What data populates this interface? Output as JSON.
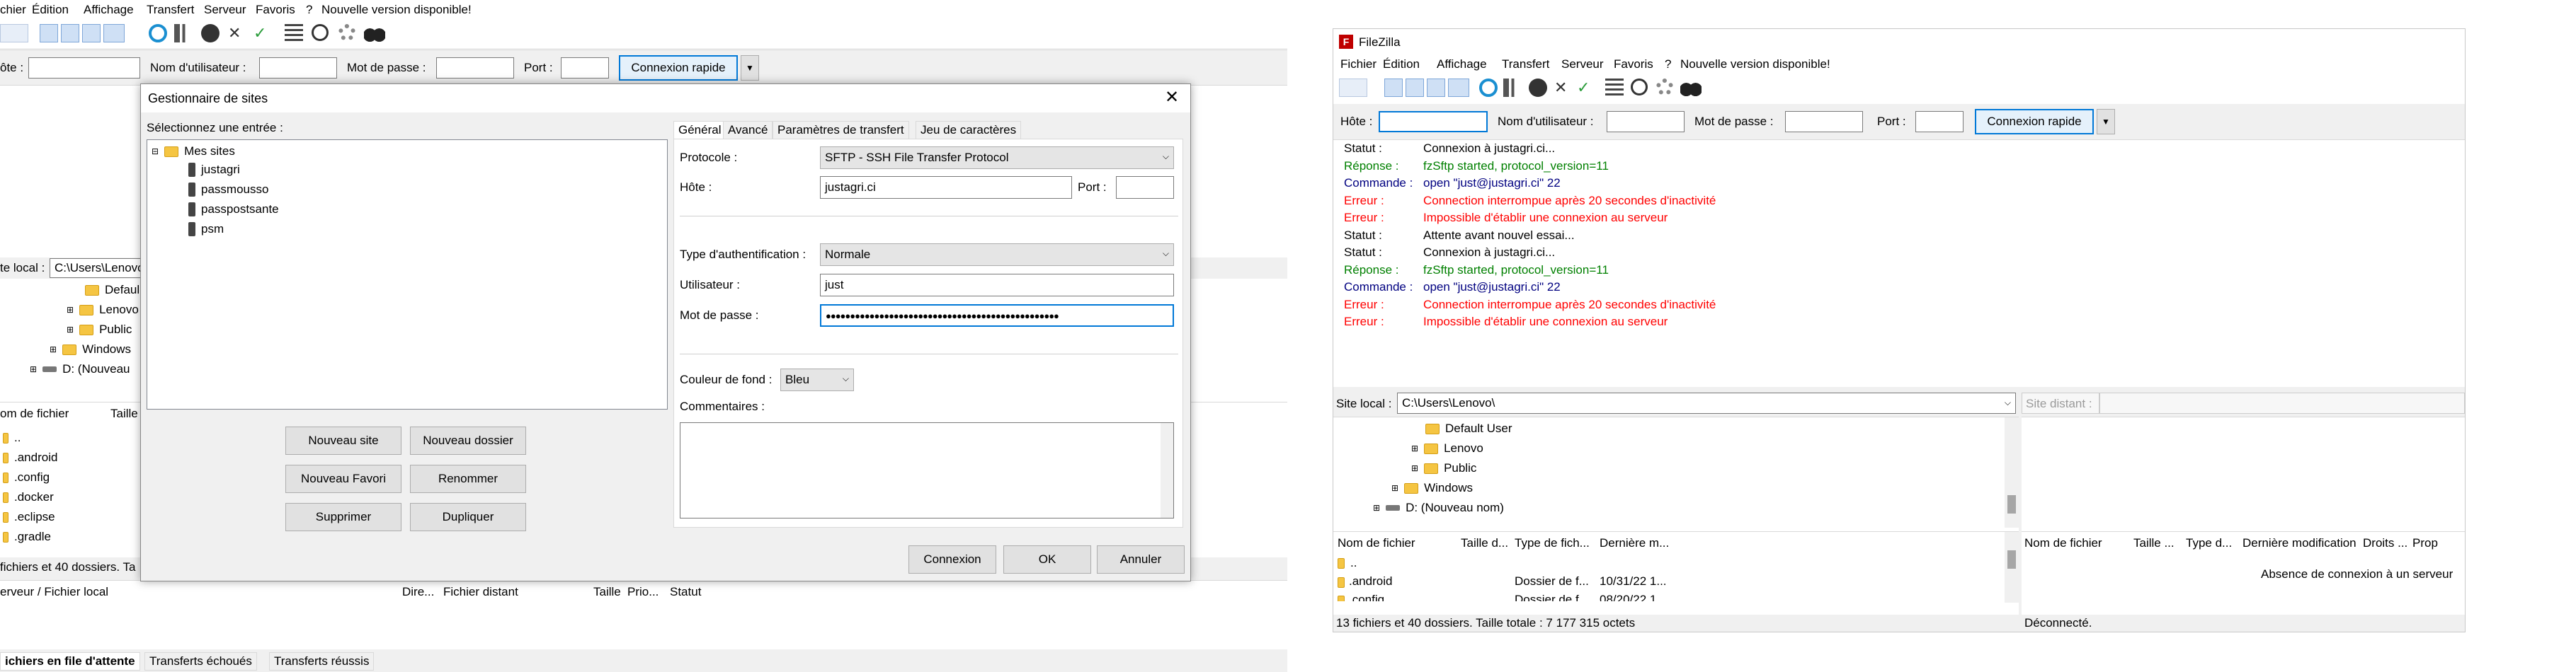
{
  "left_app": {
    "menu": [
      "chier",
      "Édition",
      "Affichage",
      "Transfert",
      "Serveur",
      "Favoris",
      "?",
      "Nouvelle version disponible!"
    ],
    "quickconnect": {
      "host_label": "ôte :",
      "user_label": "Nom d'utilisateur :",
      "pass_label": "Mot de passe :",
      "port_label": "Port :",
      "button": "Connexion rapide"
    },
    "local_site_label": "te local :",
    "local_site_path": "C:\\Users\\Lenovo",
    "tree": [
      "Defaul",
      "Lenovo",
      "Public",
      "Windows",
      "D: (Nouveau"
    ],
    "file_headers": [
      "om de fichier",
      "Taille"
    ],
    "files": [
      "..",
      ".android",
      ".config",
      ".docker",
      ".eclipse",
      ".gradle"
    ],
    "status_bar": "fichiers et 40 dossiers. Ta",
    "queue_headers": [
      "erveur / Fichier local",
      "Dire...",
      "Fichier distant",
      "Taille",
      "Prio...",
      "Statut"
    ],
    "queue_tabs": [
      "ichiers en file d'attente",
      "Transferts échoués",
      "Transferts réussis"
    ]
  },
  "dialog": {
    "title": "Gestionnaire de sites",
    "select_label": "Sélectionnez une entrée :",
    "tree_root": "Mes sites",
    "sites": [
      "justagri",
      "passmousso",
      "passpostsante",
      "psm"
    ],
    "buttons": {
      "new_site": "Nouveau site",
      "new_folder": "Nouveau dossier",
      "new_bookmark": "Nouveau Favori",
      "rename": "Renommer",
      "delete": "Supprimer",
      "duplicate": "Dupliquer"
    },
    "tabs": [
      "Général",
      "Avancé",
      "Paramètres de transfert",
      "Jeu de caractères"
    ],
    "fields": {
      "protocol_label": "Protocole :",
      "protocol_value": "SFTP - SSH File Transfer Protocol",
      "host_label": "Hôte :",
      "host_value": "justagri.ci",
      "port_label": "Port :",
      "port_value": "",
      "auth_label": "Type d'authentification :",
      "auth_value": "Normale",
      "user_label": "Utilisateur :",
      "user_value": "just",
      "pass_label": "Mot de passe :",
      "pass_value": "●●●●●●●●●●●●●●●●●●●●●●●●●●●●●●●●●●●●●●●●●●●●●●●●",
      "bg_color_label": "Couleur de fond :",
      "bg_color_value": "Bleu",
      "comments_label": "Commentaires :"
    },
    "footer": {
      "connect": "Connexion",
      "ok": "OK",
      "cancel": "Annuler"
    }
  },
  "right_app": {
    "title": "FileZilla",
    "menu": [
      "Fichier",
      "Édition",
      "Affichage",
      "Transfert",
      "Serveur",
      "Favoris",
      "?",
      "Nouvelle version disponible!"
    ],
    "quickconnect": {
      "host_label": "Hôte :",
      "user_label": "Nom d'utilisateur :",
      "pass_label": "Mot de passe :",
      "port_label": "Port :",
      "button": "Connexion rapide"
    },
    "log": [
      {
        "label": "Statut :",
        "text": "Connexion à justagri.ci...",
        "kind": "status"
      },
      {
        "label": "Réponse :",
        "text": "fzSftp started, protocol_version=11",
        "kind": "response"
      },
      {
        "label": "Commande :",
        "text": "open \"just@justagri.ci\" 22",
        "kind": "command"
      },
      {
        "label": "Erreur :",
        "text": "Connection interrompue après 20 secondes d'inactivité",
        "kind": "error"
      },
      {
        "label": "Erreur :",
        "text": "Impossible d'établir une connexion au serveur",
        "kind": "error"
      },
      {
        "label": "Statut :",
        "text": "Attente avant nouvel essai...",
        "kind": "status"
      },
      {
        "label": "Statut :",
        "text": "Connexion à justagri.ci...",
        "kind": "status"
      },
      {
        "label": "Réponse :",
        "text": "fzSftp started, protocol_version=11",
        "kind": "response"
      },
      {
        "label": "Commande :",
        "text": "open \"just@justagri.ci\" 22",
        "kind": "command"
      },
      {
        "label": "Erreur :",
        "text": "Connection interrompue après 20 secondes d'inactivité",
        "kind": "error"
      },
      {
        "label": "Erreur :",
        "text": "Impossible d'établir une connexion au serveur",
        "kind": "error"
      }
    ],
    "local_site_label": "Site local :",
    "local_site_path": "C:\\Users\\Lenovo\\",
    "remote_site_label": "Site distant :",
    "tree": [
      "Default User",
      "Lenovo",
      "Public",
      "Windows",
      "D: (Nouveau nom)"
    ],
    "local_headers": [
      "Nom de fichier",
      "Taille d...",
      "Type de fich...",
      "Dernière m..."
    ],
    "local_files": [
      {
        "name": "..",
        "type": "",
        "date": ""
      },
      {
        "name": ".android",
        "type": "Dossier de f...",
        "date": "10/31/22 1..."
      },
      {
        "name": ".config",
        "type": "Dossier de f...",
        "date": "08/20/22 1..."
      }
    ],
    "remote_headers": [
      "Nom de fichier",
      "Taille ...",
      "Type d...",
      "Dernière modification",
      "Droits ...",
      "Prop"
    ],
    "remote_message": "Absence de connexion à un serveur",
    "local_status": "13 fichiers et 40 dossiers. Taille totale : 7 177 315 octets",
    "remote_status": "Déconnecté."
  },
  "colors": {
    "status": "#000000",
    "response": "#008000",
    "command": "#000080",
    "error": "#ff0000",
    "accent": "#0078d7"
  }
}
